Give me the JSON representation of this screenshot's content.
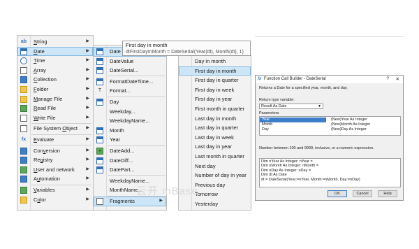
{
  "menu1": {
    "items": [
      {
        "label": "String",
        "icon": "string-icon",
        "u": "S",
        "has_submenu": true
      },
      {
        "label": "Date",
        "icon": "calendar-icon",
        "u": "D",
        "has_submenu": true,
        "highlighted": true
      },
      {
        "label": "Time",
        "icon": "clock-icon",
        "u": "T",
        "has_submenu": true
      },
      {
        "label": "Array",
        "icon": "array-icon",
        "u": "A",
        "has_submenu": true
      },
      {
        "label": "Collection",
        "icon": "collection-icon",
        "u": "C",
        "has_submenu": true
      },
      {
        "label": "Folder",
        "icon": "folder-icon",
        "u": "F",
        "has_submenu": true
      },
      {
        "label": "Manage File",
        "icon": "manage-file-icon",
        "u": "M",
        "has_submenu": true
      },
      {
        "label": "Read File",
        "icon": "read-file-icon",
        "u": "R",
        "has_submenu": true
      },
      {
        "label": "Write File",
        "icon": "write-file-icon",
        "u": "W",
        "has_submenu": true,
        "sep_after": true
      },
      {
        "label": "File System Object",
        "icon": "file-system-object-icon",
        "u": "O",
        "has_submenu": true,
        "sep_after": true
      },
      {
        "label": "Evaluate",
        "icon": "fx-icon",
        "u": "E",
        "has_submenu": true,
        "sep_after": true
      },
      {
        "label": "Conversion",
        "icon": "conversion-icon",
        "u": "v",
        "has_submenu": true
      },
      {
        "label": "Registry",
        "icon": "registry-icon",
        "u": "g",
        "has_submenu": true
      },
      {
        "label": "User and network",
        "icon": "user-network-icon",
        "u": "U",
        "has_submenu": true
      },
      {
        "label": "Automation",
        "icon": "automation-icon",
        "u": "u",
        "has_submenu": true,
        "sep_after": true
      },
      {
        "label": "Variables",
        "icon": "variables-icon",
        "u": "V",
        "has_submenu": true
      },
      {
        "label": "Color",
        "icon": "color-icon",
        "u": "o",
        "has_submenu": true
      }
    ]
  },
  "menu2": {
    "items": [
      {
        "label": "Date",
        "icon": "calendar-icon",
        "highlighted": true
      },
      {
        "label": "DateValue",
        "icon": "calendar-icon"
      },
      {
        "label": "DateSerial...",
        "icon": "calendar-icon",
        "sep_after": true
      },
      {
        "label": "FormatDateTime...",
        "icon": "calendar-icon"
      },
      {
        "label": "Format...",
        "icon": "format-icon",
        "sep_after": true
      },
      {
        "label": "Day",
        "icon": "calendar-icon"
      },
      {
        "label": "Weekday...",
        "icon": "none"
      },
      {
        "label": "WeekdayName...",
        "icon": "none"
      },
      {
        "label": "Month",
        "icon": "calendar-icon"
      },
      {
        "label": "Year",
        "icon": "calendar-icon",
        "sep_after": true
      },
      {
        "label": "DateAdd...",
        "icon": "add-icon"
      },
      {
        "label": "DateDiff...",
        "icon": "calendar-icon"
      },
      {
        "label": "DatePart...",
        "icon": "calendar-icon",
        "sep_after": true
      },
      {
        "label": "WeekdayName...",
        "icon": "none"
      },
      {
        "label": "MonthName...",
        "icon": "none",
        "sep_after": true
      },
      {
        "label": "Fragments",
        "icon": "fragments-icon",
        "has_submenu": true,
        "highlighted": true
      }
    ]
  },
  "menu3": {
    "items": [
      "Day in month",
      "First day in month",
      "First day in quarter",
      "First day in week",
      "First day in year",
      "First month in quarter",
      "Last day in month",
      "Last day in quarter",
      "Last day in week",
      "Last day in year",
      "Last month in quarter",
      "Next day",
      "Number of day in year",
      "Previous day",
      "Tomorrow",
      "Yesterday"
    ],
    "highlighted_index": 1
  },
  "tooltip": {
    "title": "First day in month",
    "formula": "dtFirstDayInMonth = DateSerial(Year(dt), Month(dt), 1)"
  },
  "dialog": {
    "title": "Function Call Builder - DateSerial",
    "help_button": "?",
    "close_button": "✕",
    "returns": "Returns a Date for a specified year, month, and day.",
    "return_type_label": "Return type variable:",
    "return_type_value": "Result As Date",
    "parameters_label": "Parameters",
    "parameters": [
      {
        "name": "Year",
        "desc": "(New)Year As Integer"
      },
      {
        "name": "Month",
        "desc": "(New)Month As Integer"
      },
      {
        "name": "Day",
        "desc": "(New)Day As Integer"
      }
    ],
    "hint": "Number between 100 and 9999, inclusive, or a numeric expression.",
    "code_lines": [
      "Dim nYear As Integer: nYear =",
      "Dim nMonth As Integer: nMonth =",
      "Dim nDay As Integer: nDay =",
      "Dim dt As Date",
      "dt = DateSerial(Year:=nYear, Month:=nMonth, Day:=nDay)"
    ],
    "ok": "OK",
    "cancel": "Cancel",
    "help": "Help"
  },
  "watermark": "云开 mBase"
}
